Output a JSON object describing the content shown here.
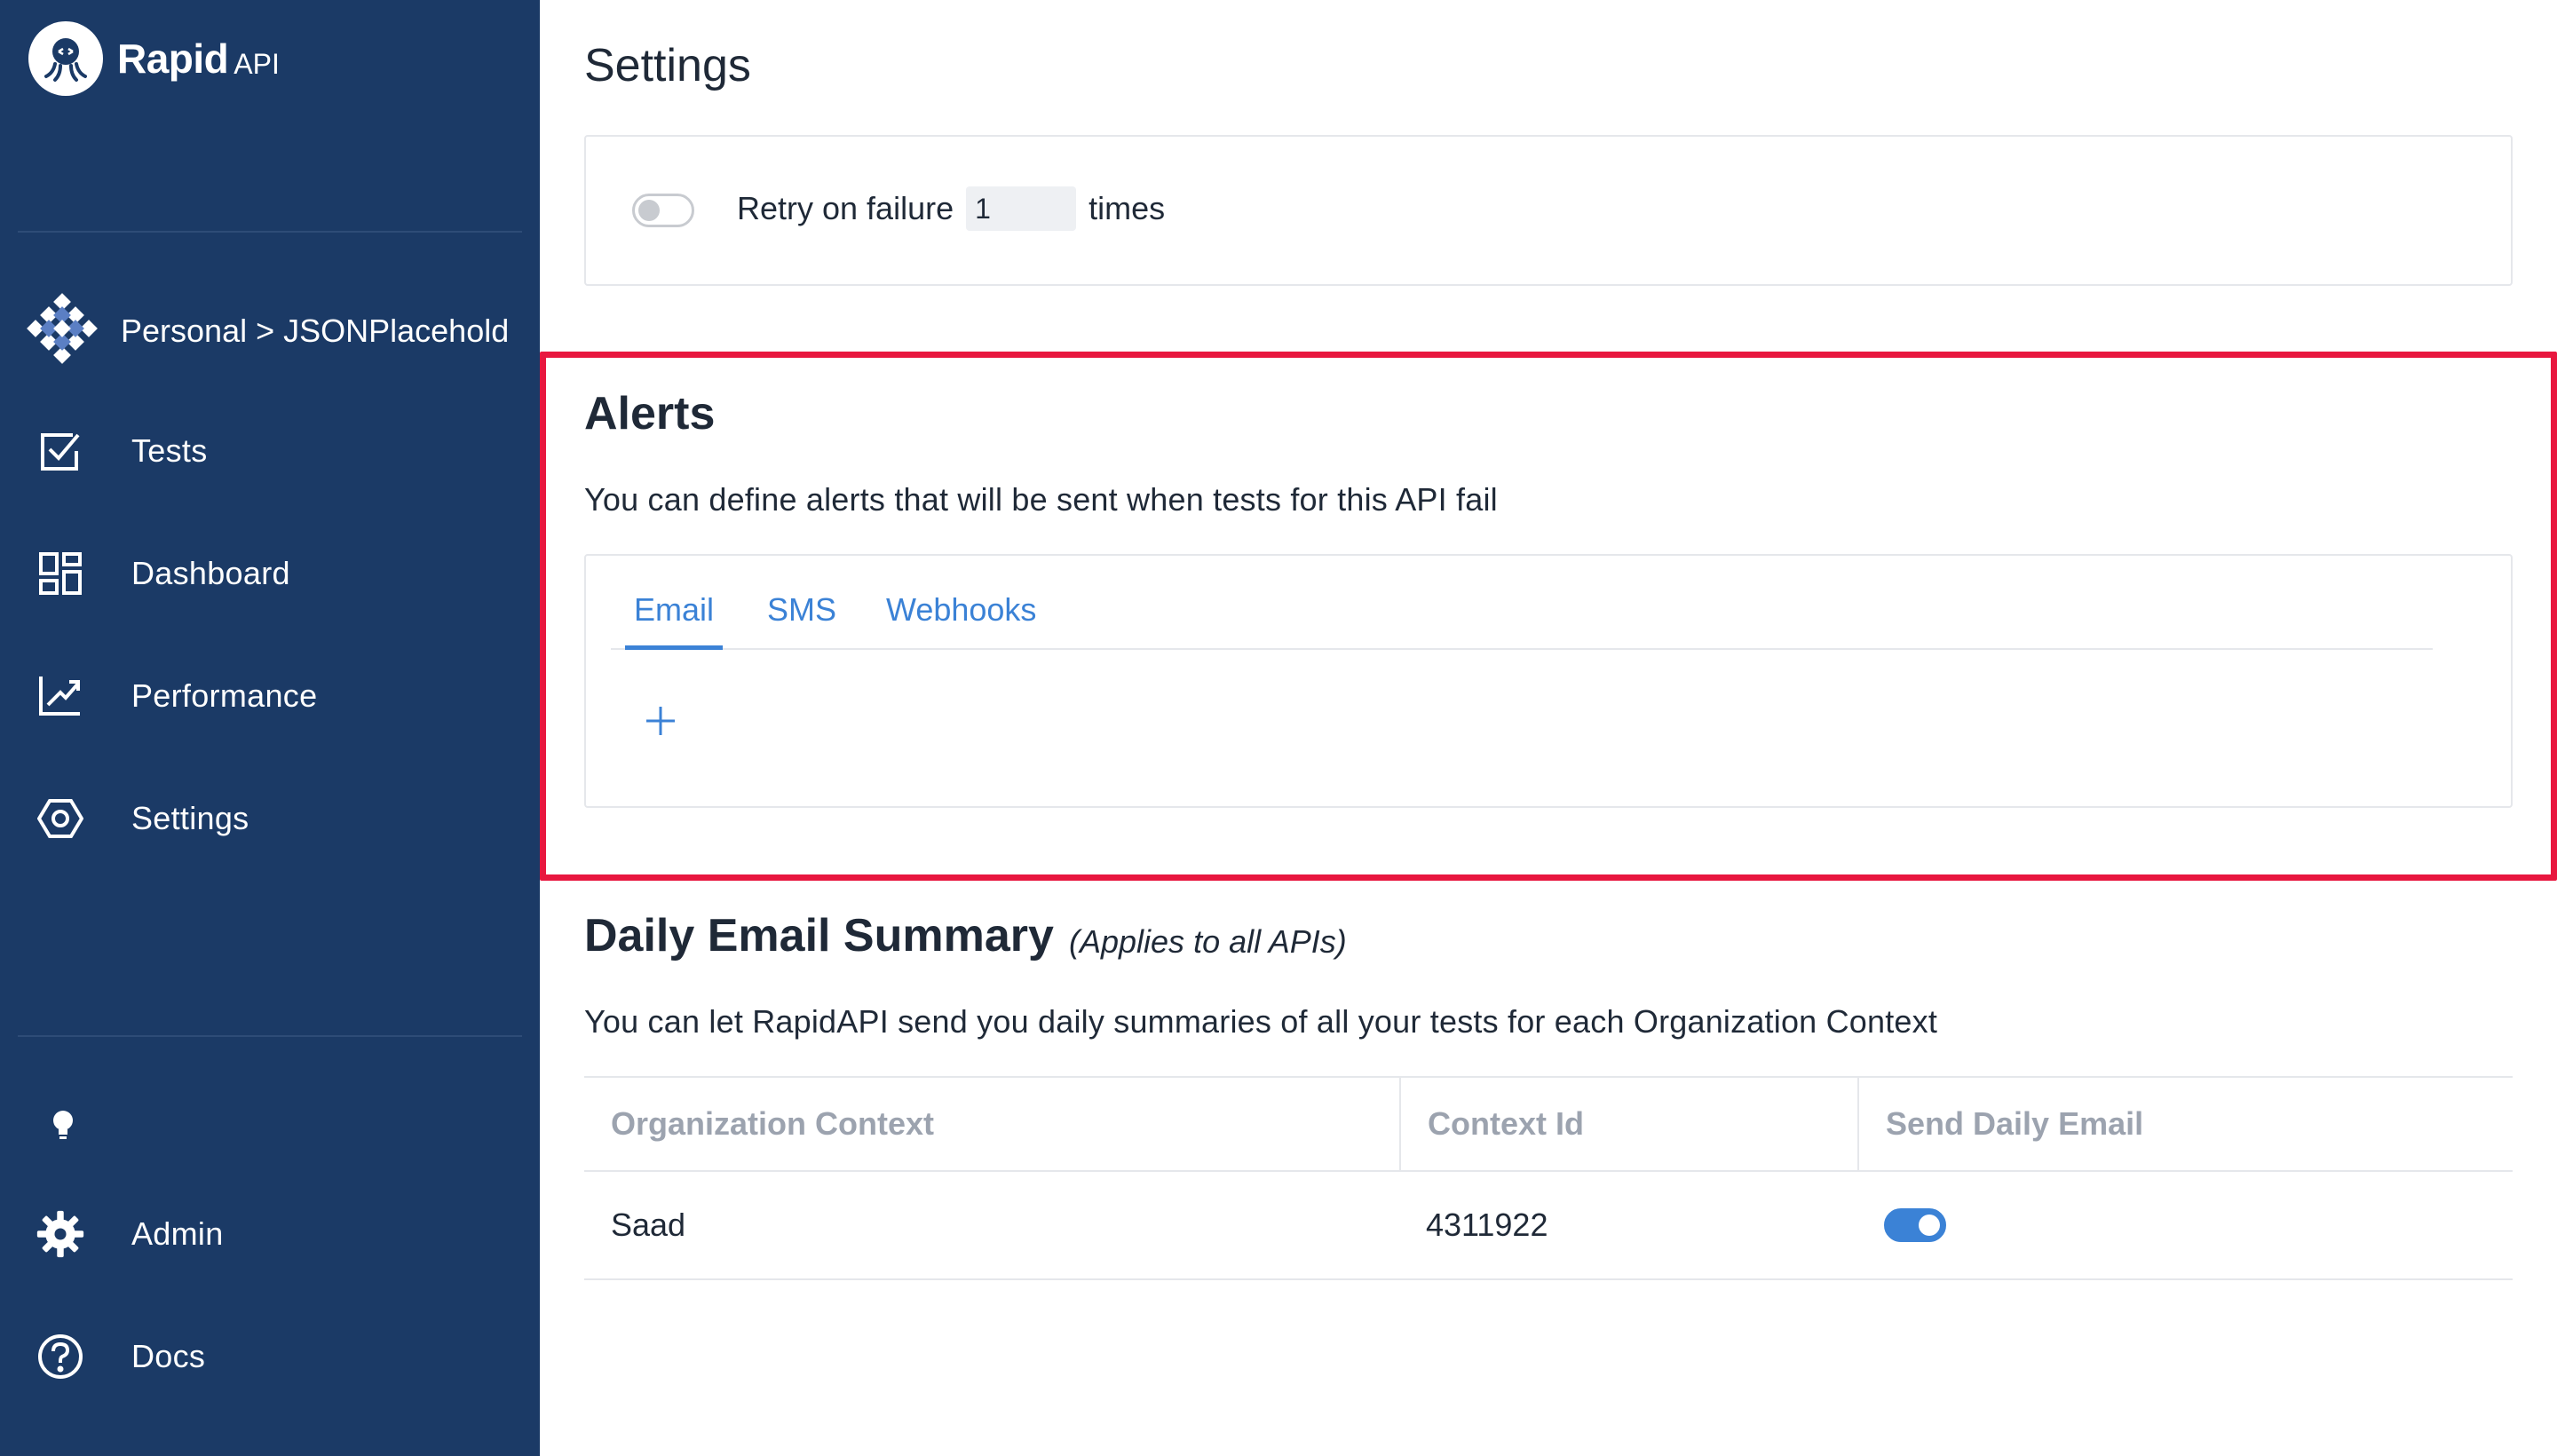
{
  "brand": {
    "name": "Rapid",
    "sub": "API"
  },
  "sidebar": {
    "context_label": "Personal > JSONPlacehold",
    "items": [
      {
        "label": "Tests",
        "icon": "checkbox-icon"
      },
      {
        "label": "Dashboard",
        "icon": "dashboard-icon"
      },
      {
        "label": "Performance",
        "icon": "chart-trend-icon"
      },
      {
        "label": "Settings",
        "icon": "hexagon-gear-icon"
      }
    ],
    "bottom_items": [
      {
        "label": "Admin",
        "icon": "gear-icon"
      },
      {
        "label": "Docs",
        "icon": "help-circle-icon"
      }
    ]
  },
  "settings": {
    "title": "Settings",
    "retry_label": "Retry on failure",
    "retry_value": "1",
    "retry_suffix": "times",
    "retry_enabled": false
  },
  "alerts": {
    "title": "Alerts",
    "description": "You can define alerts that will be sent when tests for this API fail",
    "tabs": [
      {
        "label": "Email",
        "active": true
      },
      {
        "label": "SMS",
        "active": false
      },
      {
        "label": "Webhooks",
        "active": false
      }
    ],
    "add_icon": "plus-icon"
  },
  "daily_summary": {
    "title": "Daily Email Summary",
    "note": "(Applies to all APIs)",
    "description": "You can let RapidAPI send you daily summaries of all your tests for each Organization Context",
    "columns": [
      "Organization Context",
      "Context Id",
      "Send Daily Email"
    ],
    "rows": [
      {
        "organization_context": "Saad",
        "context_id": "4311922",
        "send_daily_email": true
      }
    ]
  },
  "colors": {
    "sidebar_bg": "#1b3a66",
    "accent": "#3b82d6",
    "highlight": "#e8173f"
  }
}
